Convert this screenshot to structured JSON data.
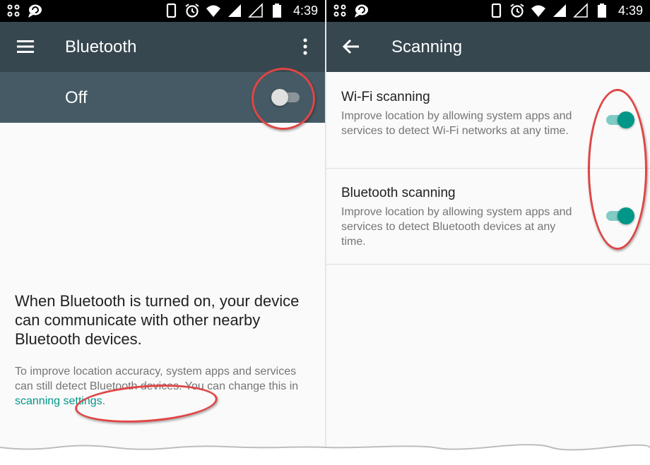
{
  "status_bar": {
    "time": "4:39",
    "icons": [
      "app-icon",
      "chat-icon",
      "phone-icon",
      "alarm-icon",
      "wifi-icon",
      "signal-icon",
      "signal-empty-icon",
      "battery-icon"
    ]
  },
  "bluetooth_screen": {
    "title": "Bluetooth",
    "menu_icon": "hamburger-menu-icon",
    "overflow_icon": "more-vert-icon",
    "switch_label": "Off",
    "switch_state": "off",
    "description": "When Bluetooth is turned on, your device can communicate with other nearby Bluetooth devices.",
    "note_text": "To improve location accuracy, system apps and services can still detect Bluetooth devices. You can change this in ",
    "note_link": "scanning settings",
    "note_end": "."
  },
  "scanning_screen": {
    "title": "Scanning",
    "back_icon": "arrow-back-icon",
    "items": [
      {
        "title": "Wi-Fi scanning",
        "summary": "Improve location by allowing system apps and services to detect Wi-Fi networks at any time.",
        "state": "on"
      },
      {
        "title": "Bluetooth scanning",
        "summary": "Improve location by allowing system apps and services to detect Bluetooth devices at any time.",
        "state": "on"
      }
    ]
  },
  "colors": {
    "toolbar": "#37474f",
    "switch_bar": "#455a64",
    "accent": "#009688",
    "annotation": "#e04545"
  }
}
